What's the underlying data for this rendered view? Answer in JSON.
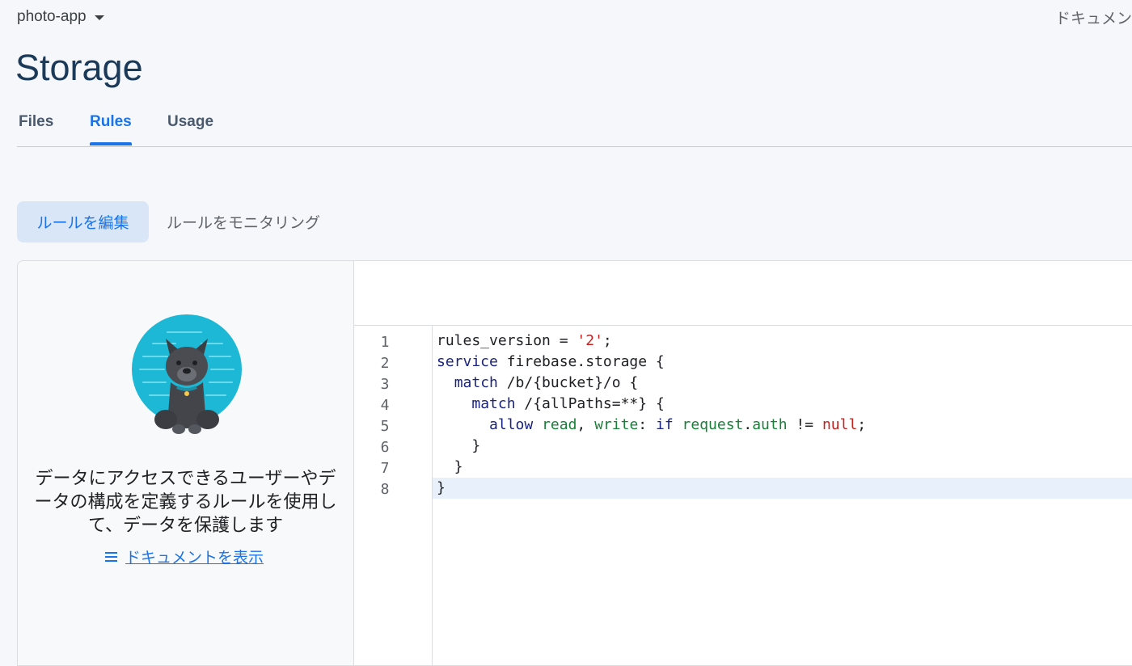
{
  "header": {
    "project": "photo-app",
    "doc_link": "ドキュメン"
  },
  "page": {
    "title": "Storage"
  },
  "tabs": [
    {
      "label": "Files"
    },
    {
      "label": "Rules"
    },
    {
      "label": "Usage"
    }
  ],
  "subnav": {
    "edit": "ルールを編集",
    "monitor": "ルールをモニタリング"
  },
  "info": {
    "description": "データにアクセスできるユーザーやデータの構成を定義するルールを使用して、データを保護します",
    "link": "ドキュメントを表示"
  },
  "editor": {
    "line_numbers": [
      "1",
      "2",
      "3",
      "4",
      "5",
      "6",
      "7",
      "8"
    ],
    "lines": [
      "rules_version = '2';",
      "service firebase.storage {",
      "  match /b/{bucket}/o {",
      "    match /{allPaths=**} {",
      "      allow read, write: if request.auth != null;",
      "    }",
      "  }",
      "}"
    ],
    "tokens": {
      "l1_a": "rules_version = ",
      "l1_b": "'2'",
      "l1_c": ";",
      "l2_a": "service",
      "l2_b": " firebase.storage {",
      "l3_a": "  ",
      "l3_b": "match",
      "l3_c": " /b/{bucket}/o {",
      "l4_a": "    ",
      "l4_b": "match",
      "l4_c": " /{allPaths=**} {",
      "l5_a": "      ",
      "l5_b": "allow",
      "l5_c": " ",
      "l5_d": "read",
      "l5_e": ", ",
      "l5_f": "write",
      "l5_g": ": ",
      "l5_h": "if",
      "l5_i": " ",
      "l5_j": "request",
      "l5_k": ".",
      "l5_l": "auth",
      "l5_m": " != ",
      "l5_n": "null",
      "l5_o": ";",
      "l6": "    }",
      "l7": "  }",
      "l8": "}"
    },
    "highlighted_line": 8
  },
  "colors": {
    "accent": "#1a73e8",
    "title": "#1b3a5a",
    "keyword": "#1a237e",
    "identifier": "#188038",
    "literal": "#c5221f"
  }
}
